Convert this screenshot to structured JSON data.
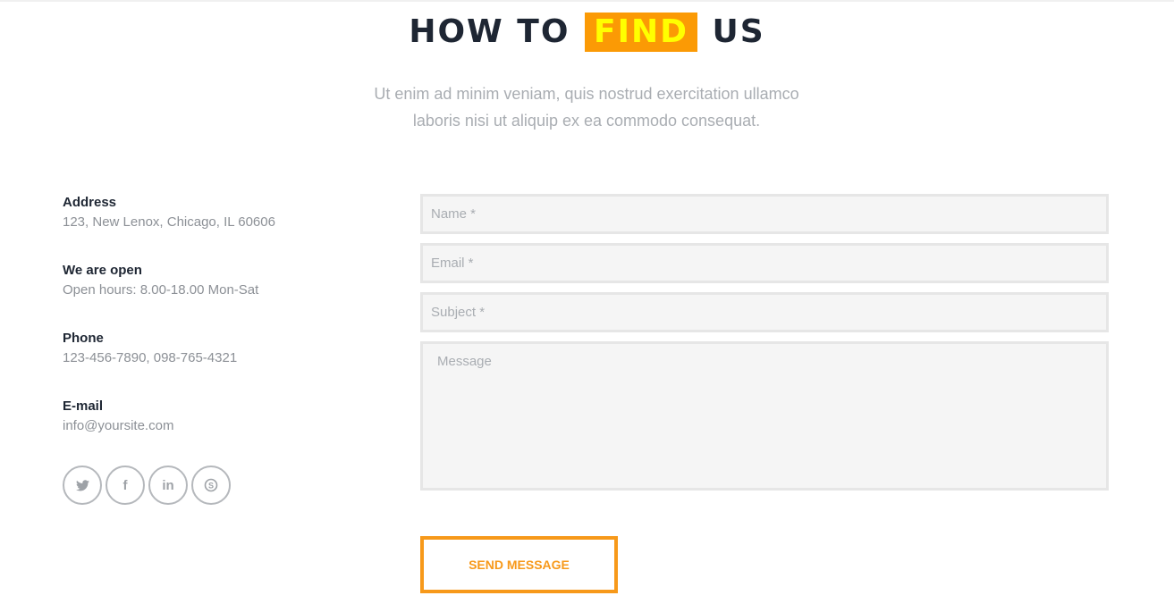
{
  "heading": {
    "before": "HOW TO ",
    "highlight": "FIND",
    "after": " US"
  },
  "subtitle": {
    "line1": "Ut enim ad minim veniam, quis nostrud exercitation ullamco",
    "line2": "laboris nisi ut aliquip ex ea commodo consequat."
  },
  "info": [
    {
      "label": "Address",
      "value": "123, New Lenox, Chicago, IL 60606"
    },
    {
      "label": "We are open",
      "value": "Open hours: 8.00-18.00 Mon-Sat"
    },
    {
      "label": "Phone",
      "value": "123-456-7890, 098-765-4321"
    },
    {
      "label": "E-mail",
      "value": "info@yoursite.com"
    }
  ],
  "social": [
    {
      "icon": "twitter-icon",
      "glyph": "🐦"
    },
    {
      "icon": "facebook-icon",
      "glyph": "f"
    },
    {
      "icon": "linkedin-icon",
      "glyph": "in"
    },
    {
      "icon": "skype-icon",
      "glyph": "S"
    }
  ],
  "form": {
    "name_placeholder": "Name *",
    "email_placeholder": "Email *",
    "subject_placeholder": "Subject *",
    "message_placeholder": "Message",
    "send_label": "SEND MESSAGE"
  },
  "colors": {
    "accent": "#fb9a05",
    "highlight_text": "#ffff00",
    "heading": "#1e2633"
  }
}
